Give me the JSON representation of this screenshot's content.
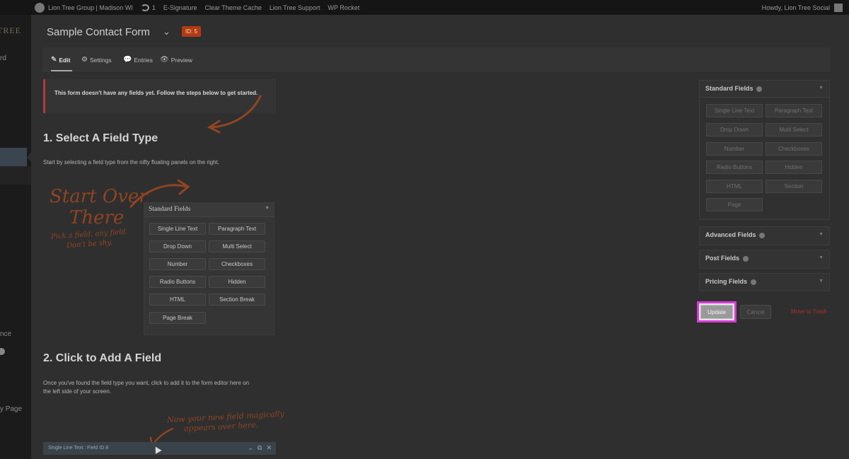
{
  "adminbar": {
    "site_name": "Lion Tree Group | Madison WI",
    "sync_count": "1",
    "items": [
      "E-Signature",
      "Clear Theme Cache",
      "Lion Tree Support",
      "WP Rocket"
    ],
    "howdy": "Howdy, Lion Tree Social"
  },
  "sidebar": {
    "logo_text": "TREE",
    "fragments": [
      "rd",
      "nce",
      "y Page"
    ]
  },
  "header": {
    "title": "Sample Contact Form",
    "id_badge": "ID: 5"
  },
  "tabs": [
    {
      "label": "Edit",
      "icon": "pencil-icon"
    },
    {
      "label": "Settings",
      "icon": "gears-icon"
    },
    {
      "label": "Entries",
      "icon": "speech-bubble-icon"
    },
    {
      "label": "Preview",
      "icon": "eye-icon"
    }
  ],
  "notice": {
    "text": "This form doesn't have any fields yet. Follow the steps below to get started."
  },
  "step1": {
    "heading": "1. Select A Field Type",
    "description": "Start by selecting a field type from the nifty floating panels on the right."
  },
  "illustration": {
    "headline_line1": "Start Over",
    "headline_line2": "There",
    "caption_line1": "Pick a field, any field.",
    "caption_line2": "Don't be shy.",
    "panel_title": "Standard Fields",
    "buttons": [
      "Single Line Text",
      "Paragraph Text",
      "Drop Down",
      "Multi Select",
      "Number",
      "Checkboxes",
      "Radio Buttons",
      "Hidden",
      "HTML",
      "Section Break",
      "Page Break"
    ]
  },
  "step2": {
    "heading": "2. Click to Add A Field",
    "description_line1": "Once you've found the field type you want, click to add it to the form editor here on",
    "description_line2": "the left side of your screen.",
    "annotation_line1": "Now your new field magically",
    "annotation_line2": "appears over here.",
    "field_bar_label": "Single Line Text : Field ID 8"
  },
  "right_panels": {
    "standard": {
      "title": "Standard Fields",
      "buttons": [
        "Single Line Text",
        "Paragraph Text",
        "Drop Down",
        "Multi Select",
        "Number",
        "Checkboxes",
        "Radio Buttons",
        "Hidden",
        "HTML",
        "Section",
        "Page"
      ]
    },
    "advanced": {
      "title": "Advanced Fields"
    },
    "post": {
      "title": "Post Fields"
    },
    "pricing": {
      "title": "Pricing Fields"
    }
  },
  "actions": {
    "update": "Update",
    "cancel": "Cancel",
    "trash": "Move to Trash"
  },
  "colors": {
    "accent_badge": "#b23a10",
    "highlight_border": "#d83ad8",
    "trash_link": "#b23030",
    "handwriting": "#8f4422"
  }
}
